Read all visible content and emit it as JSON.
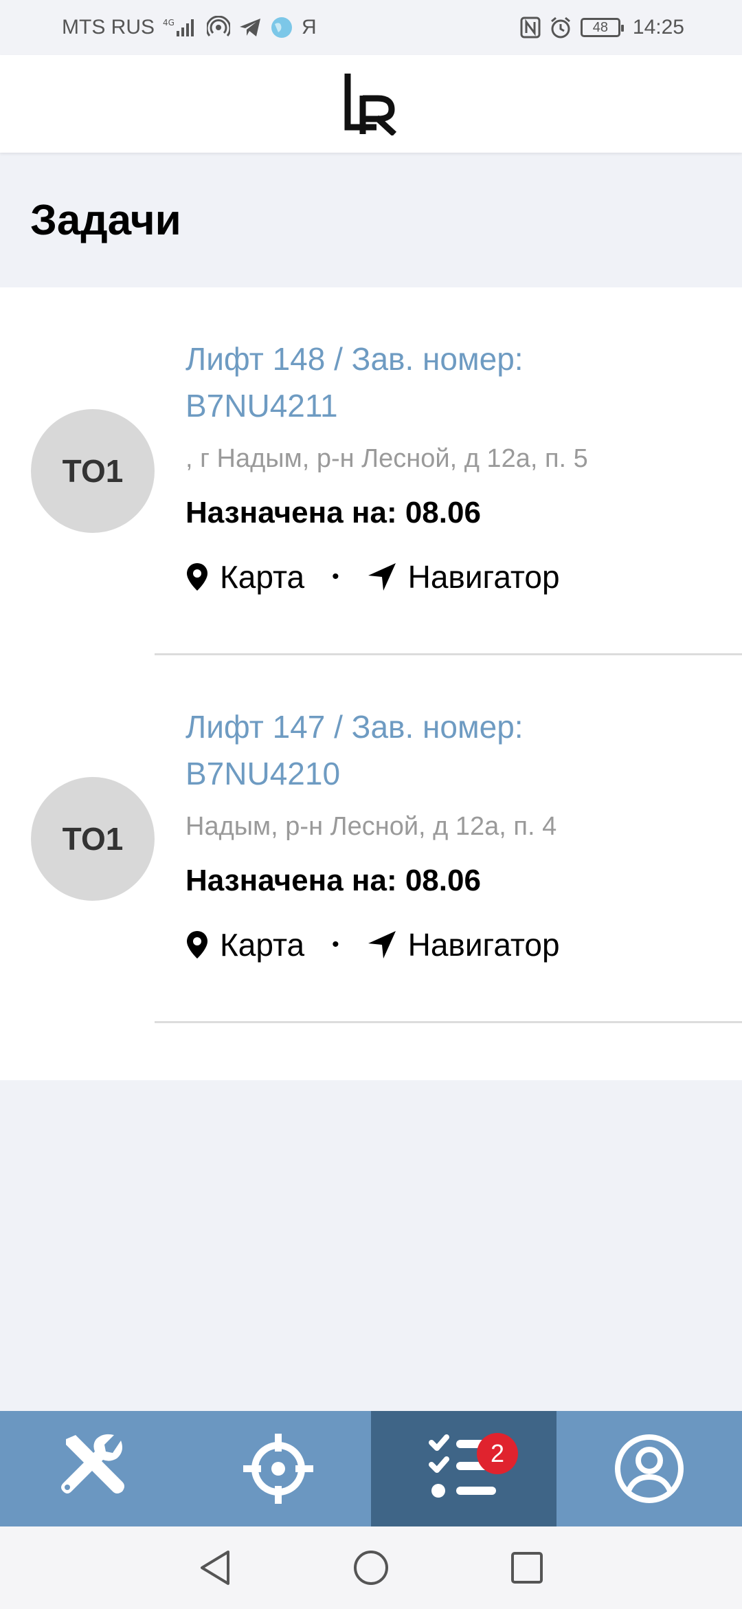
{
  "status_bar": {
    "carrier": "MTS RUS",
    "network": "4G",
    "yandex_glyph": "Я",
    "battery_level": "48",
    "time": "14:25"
  },
  "header": {
    "logo_text": "LR"
  },
  "page": {
    "title": "Задачи"
  },
  "tasks": [
    {
      "avatar_text": "TO1",
      "title_line1": "Лифт 148 / Зав. номер:",
      "title_line2": "B7NU4211",
      "address": ", г Надым, р-н Лесной, д 12а, п. 5",
      "assigned": "Назначена на: 08.06",
      "map_label": "Карта",
      "separator": "•",
      "navigator_label": "Навигатор"
    },
    {
      "avatar_text": "TO1",
      "title_line1": "Лифт 147 / Зав. номер:",
      "title_line2": "B7NU4210",
      "address": "Надым, р-н Лесной, д 12а, п. 4",
      "assigned": "Назначена на: 08.06",
      "map_label": "Карта",
      "separator": "•",
      "navigator_label": "Навигатор"
    }
  ],
  "tab_bar": {
    "tabs": [
      {
        "icon": "tools-icon"
      },
      {
        "icon": "crosshair-icon"
      },
      {
        "icon": "task-list-icon",
        "active": true,
        "badge": "2"
      },
      {
        "icon": "profile-icon"
      }
    ]
  },
  "colors": {
    "accent": "#6b97c1",
    "accent_active": "#3f6587",
    "title_link": "#6e9bc2",
    "badge": "#e0232e"
  }
}
